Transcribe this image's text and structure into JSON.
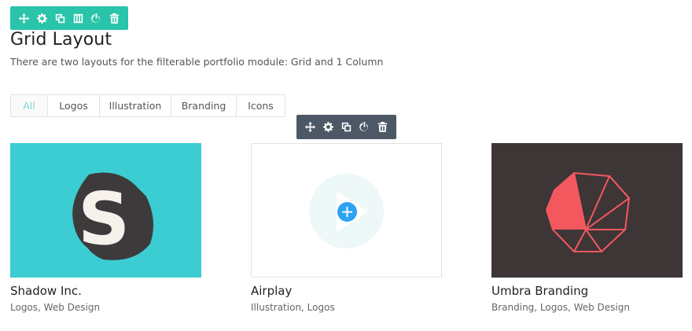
{
  "section_toolbar": {
    "buttons": [
      "move-icon",
      "settings-icon",
      "duplicate-icon",
      "columns-icon",
      "power-icon",
      "trash-icon"
    ]
  },
  "module_toolbar": {
    "buttons": [
      "move-icon",
      "settings-icon",
      "duplicate-icon",
      "power-icon",
      "trash-icon"
    ]
  },
  "heading": {
    "title": "Grid Layout",
    "description": "There are two layouts for the filterable portfolio module: Grid and 1 Column"
  },
  "filters": {
    "items": [
      "All",
      "Logos",
      "Illustration",
      "Branding",
      "Icons"
    ],
    "active": "All"
  },
  "portfolio": {
    "items": [
      {
        "title": "Shadow Inc.",
        "categories": "Logos, Web Design"
      },
      {
        "title": "Airplay",
        "categories": "Illustration, Logos"
      },
      {
        "title": "Umbra Branding",
        "categories": "Branding, Logos, Web Design"
      }
    ]
  },
  "colors": {
    "section_toolbar": "#29c4a9",
    "module_toolbar": "#4c5866",
    "active_filter": "#7fd4de",
    "add_button": "#2ea3f2",
    "teal_thumb": "#3bcdd1",
    "dark_thumb": "#3e3537",
    "logo_red": "#f2585e"
  }
}
